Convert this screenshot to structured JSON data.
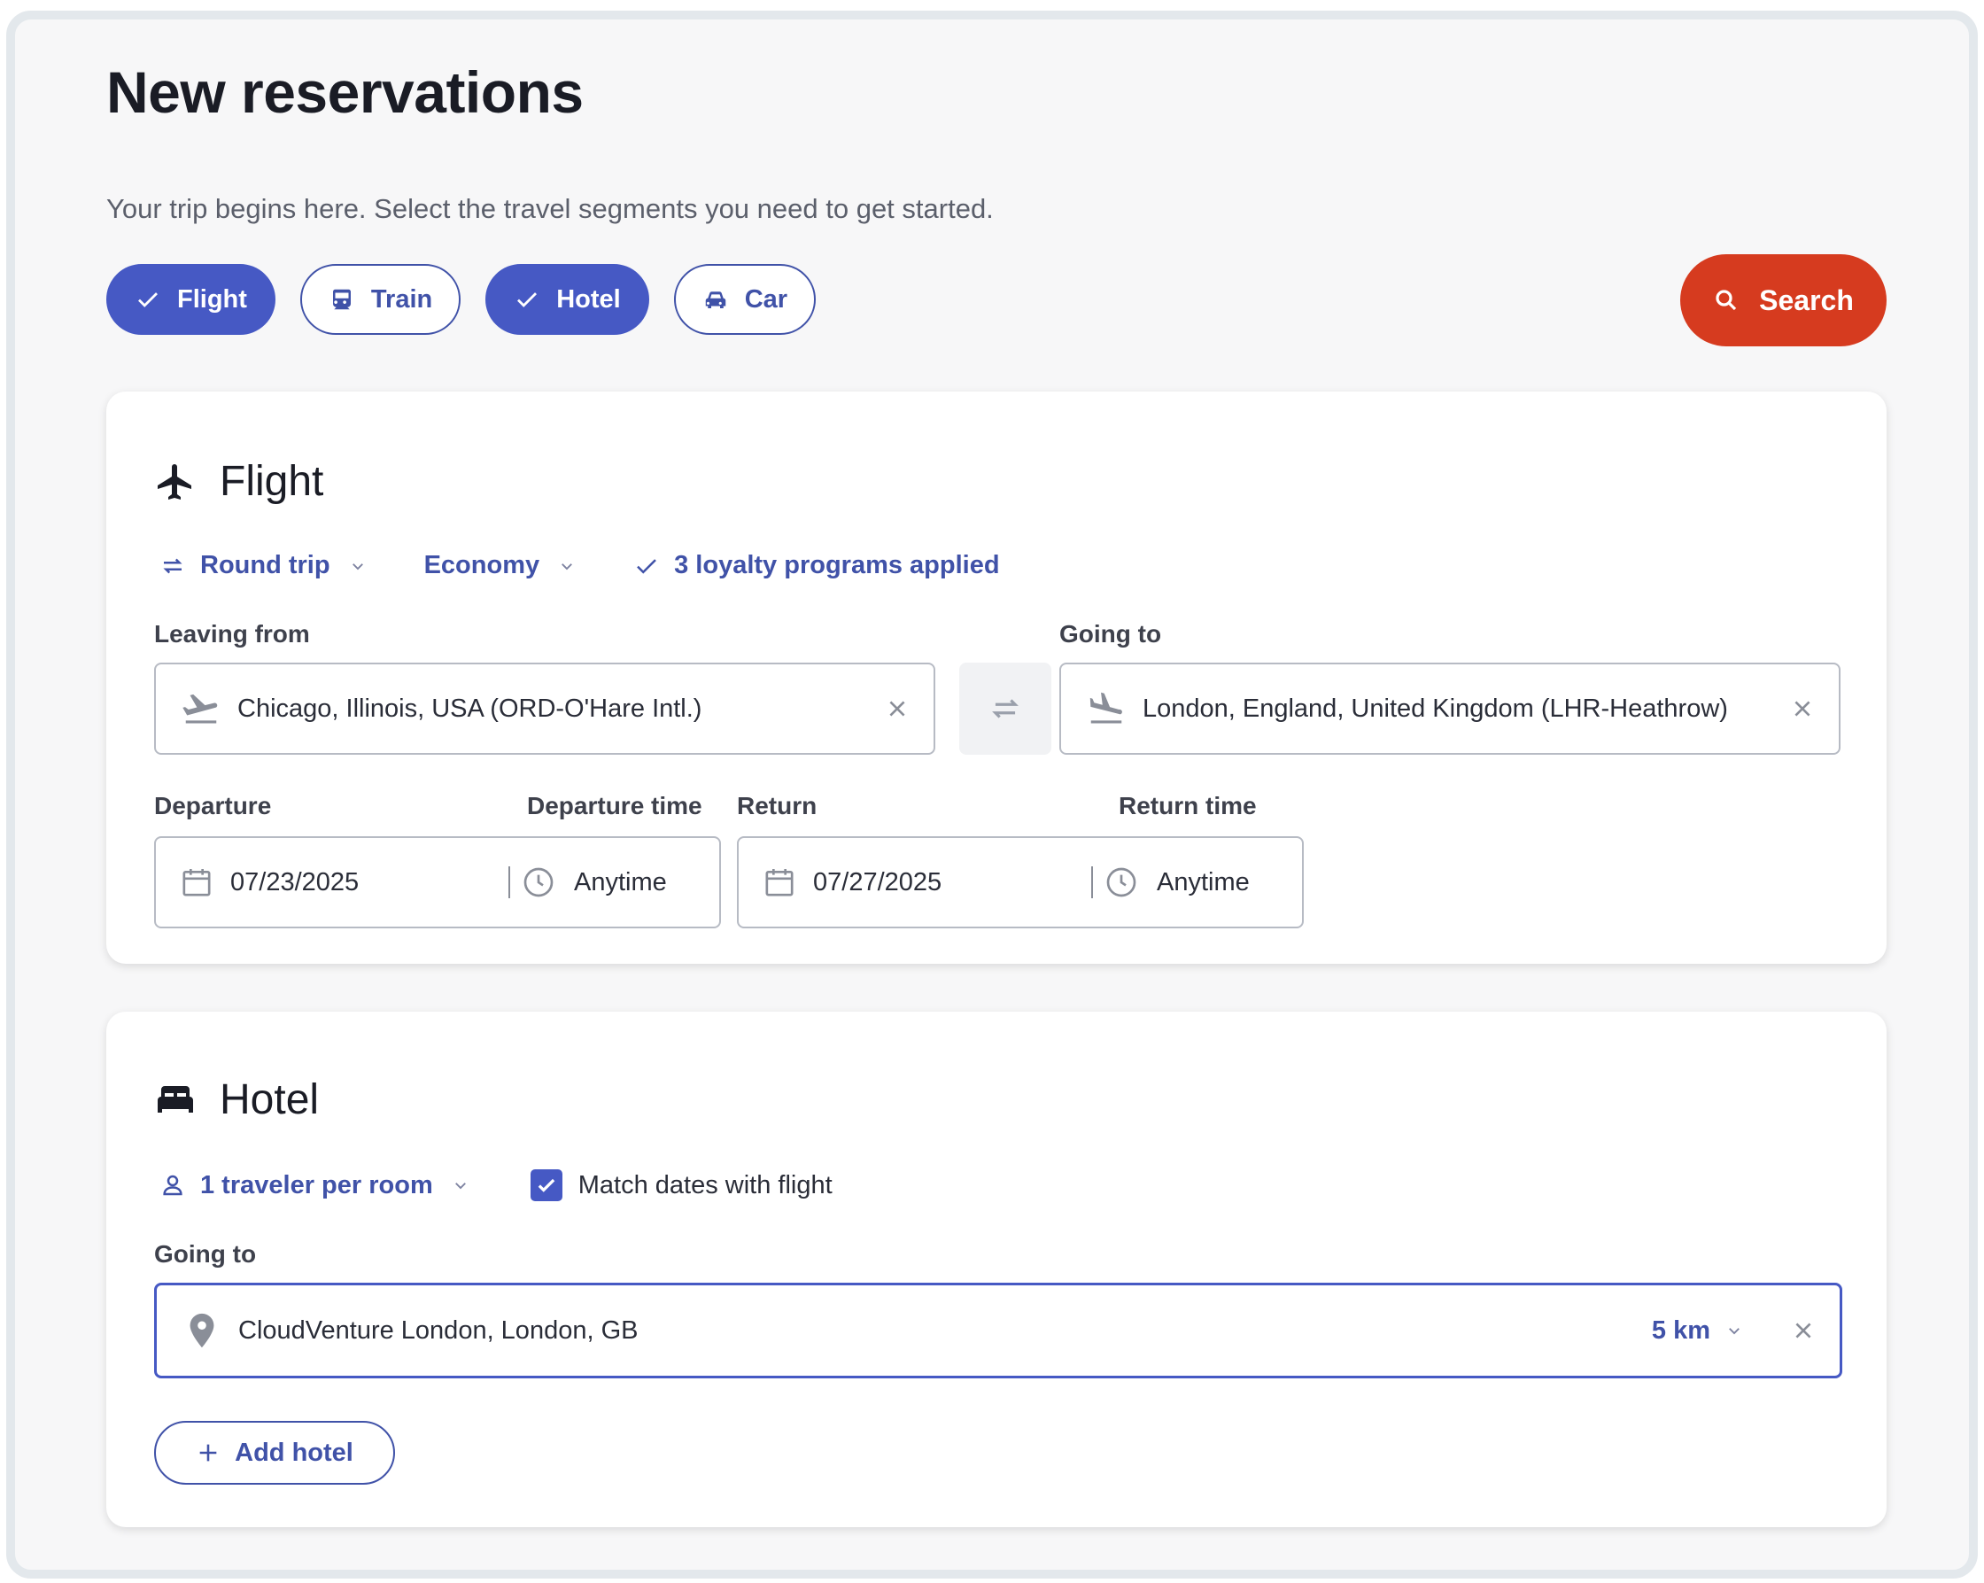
{
  "page": {
    "title": "New reservations",
    "subtitle": "Your trip begins here. Select the travel segments you need to get started."
  },
  "segments": [
    {
      "label": "Flight",
      "selected": true,
      "icon": "check-icon"
    },
    {
      "label": "Train",
      "selected": false,
      "icon": "train-icon"
    },
    {
      "label": "Hotel",
      "selected": true,
      "icon": "check-icon"
    },
    {
      "label": "Car",
      "selected": false,
      "icon": "car-icon"
    }
  ],
  "search": {
    "label": "Search"
  },
  "flight": {
    "title": "Flight",
    "trip_type": "Round trip",
    "cabin": "Economy",
    "loyalty": "3 loyalty programs applied",
    "leaving_label": "Leaving from",
    "leaving_value": "Chicago, Illinois, USA (ORD-O'Hare Intl.)",
    "going_label": "Going to",
    "going_value": "London, England, United Kingdom (LHR-Heathrow)",
    "departure_label": "Departure",
    "departure_time_label": "Departure time",
    "return_label": "Return",
    "return_time_label": "Return time",
    "departure_date": "07/23/2025",
    "departure_time": "Anytime",
    "return_date": "07/27/2025",
    "return_time": "Anytime"
  },
  "hotel": {
    "title": "Hotel",
    "travelers": "1 traveler per room",
    "match_dates_label": "Match dates with flight",
    "match_dates_checked": true,
    "going_label": "Going to",
    "going_value": "CloudVenture London, London, GB",
    "radius": "5 km",
    "add_hotel": "Add hotel"
  },
  "colors": {
    "accent": "#4659c4",
    "link": "#4052a8",
    "search": "#d63b1f",
    "background": "#f7f7f8"
  }
}
